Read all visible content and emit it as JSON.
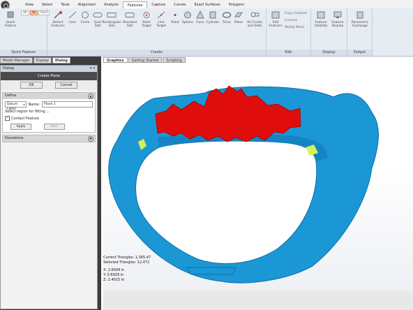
{
  "menu": {
    "tabs": [
      "View",
      "Select",
      "Tools",
      "Alignment",
      "Analysis",
      "Features",
      "Capture",
      "Curves",
      "Exact Surfaces",
      "Polygons"
    ],
    "active_tab": "Features"
  },
  "ribbon": {
    "quick_feature": {
      "selectors": [
        "All",
        "All",
        "Face"
      ],
      "button": "Quick Feature",
      "group_label": "Quick Feature"
    },
    "create": {
      "buttons": [
        "Detect Features",
        "Line",
        "Circle",
        "Oval Slot",
        "Rectangular Slot",
        "Rounded Slot",
        "Point Target",
        "Line Target",
        "Point",
        "Sphere",
        "Cone",
        "Cylinder",
        "Torus",
        "Plane",
        "All Circles and Slots"
      ],
      "group_label": "Create"
    },
    "edit": {
      "buttons": [
        "Edit Features",
        "Copy Features",
        "Convert",
        "Modify Mesh"
      ],
      "group_label": "Edit"
    },
    "display": {
      "buttons": [
        "Feature Visibility",
        "Feature Display"
      ],
      "group_label": "Display"
    },
    "output": {
      "buttons": [
        "Parametric Exchange"
      ],
      "group_label": "Output"
    }
  },
  "panel": {
    "tabs": [
      "Model Manager",
      "Display",
      "Dialog"
    ],
    "active_tab": "Dialog",
    "dialog_title": "Dialog",
    "dialog_name": "Create Plane",
    "ok_label": "OK",
    "cancel_label": "Cancel",
    "define": {
      "header": "Define",
      "datum_label": "Datum Label:",
      "datum_value": "",
      "name_label": "Name:",
      "name_value": "Plane 1",
      "hint": "Select region for fitting ...",
      "contact_feature": "Contact Feature",
      "contact_checked": true,
      "apply_label": "Apply",
      "next_label": "Next"
    },
    "deviations_header": "Deviations"
  },
  "canvas": {
    "tabs": [
      "Graphics",
      "Getting Started",
      "Scripting"
    ],
    "active_tab": "Graphics",
    "stats": {
      "current_triangles": "Current Triangles: 1,365,47",
      "selected_triangles": "Selected Triangles: 12,472",
      "x": "X:  2.6004 in",
      "y": "Y:  0.6929 in",
      "z": "Z:  2.4015 in"
    }
  },
  "colors": {
    "mesh": "#1b97d6",
    "selection": "#e00d0d",
    "highlight": "#d7f05a",
    "ribbon_bg": "#e7ecf3",
    "panel_bg": "#3d3d3d"
  }
}
